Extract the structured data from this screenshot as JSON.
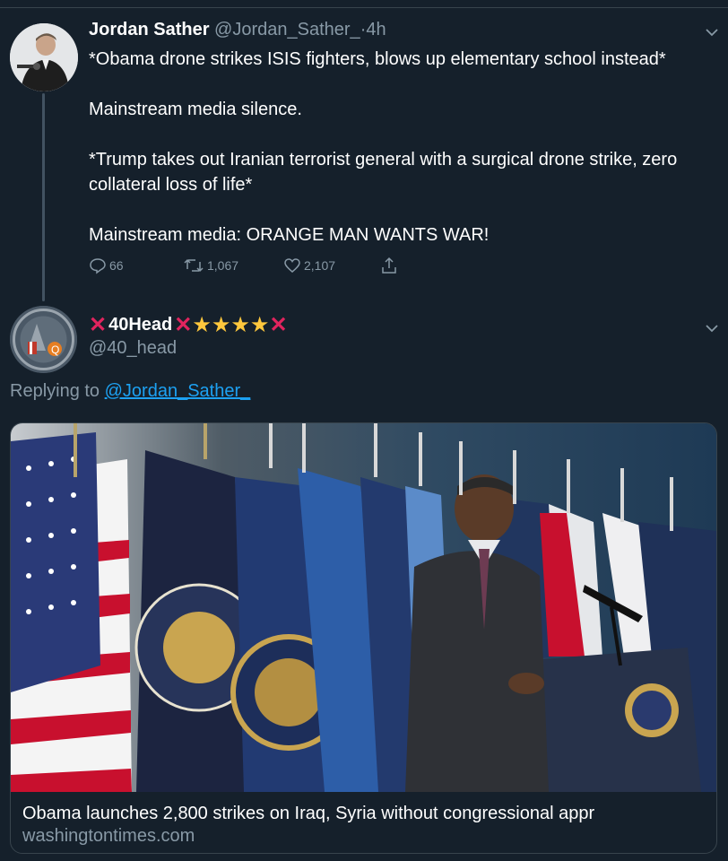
{
  "tweet": {
    "author_name": "Jordan Sather",
    "author_handle": "@Jordan_Sather_",
    "separator": "·",
    "time": "4h",
    "lines": [
      "*Obama drone strikes ISIS fighters, blows up elementary school instead*",
      "Mainstream media silence.",
      "*Trump takes out Iranian terrorist general with a surgical drone strike, zero collateral loss of life*",
      "Mainstream media: ORANGE MAN WANTS WAR!"
    ],
    "replies": "66",
    "retweets": "1,067",
    "likes": "2,107"
  },
  "reply": {
    "display_name": "40Head",
    "handle": "@40_head",
    "replying_prefix": "Replying to",
    "replying_to": "@Jordan_Sather_"
  },
  "card": {
    "title": "Obama launches 2,800 strikes on Iraq, Syria without congressional appr",
    "domain": "washingtontimes.com"
  },
  "icons": {
    "reply": "comment-icon",
    "retweet": "retweet-icon",
    "like": "heart-icon",
    "share": "share-icon",
    "menu": "chevron-down-icon",
    "cross": "red-cross-emoji",
    "star": "star-emoji"
  },
  "colors": {
    "background": "#15202b",
    "muted": "#8899a6",
    "link": "#1da1f2",
    "border": "#38444d"
  }
}
